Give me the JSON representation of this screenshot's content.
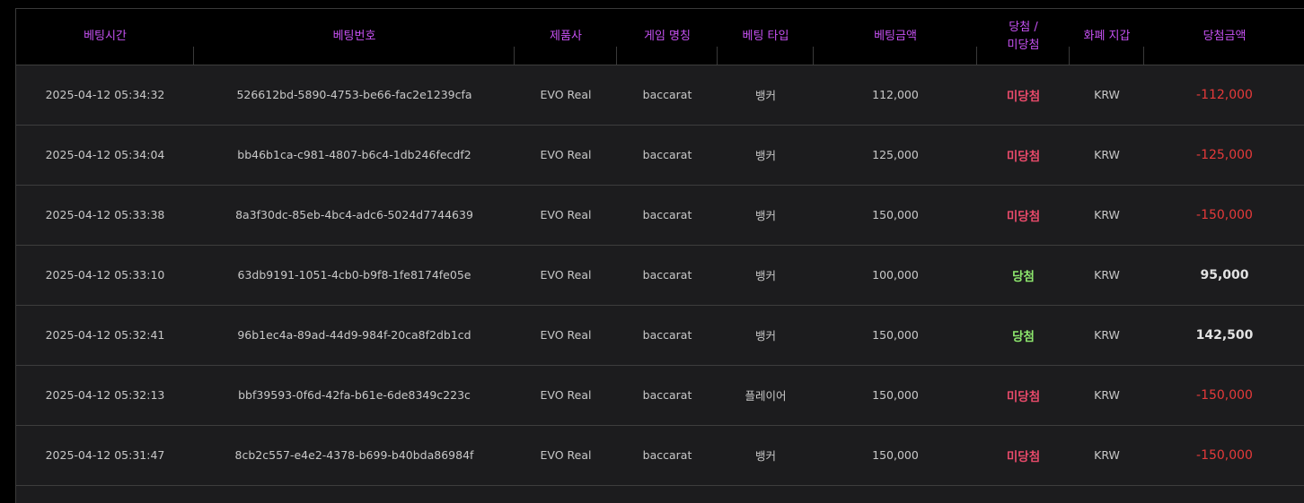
{
  "colors": {
    "header_text": "#c651f2",
    "lose_result": "#e84a6a",
    "win_result": "#8ee86e",
    "lose_amount": "#e53a3a",
    "win_amount": "#e2e2e2"
  },
  "headers": {
    "bet_time": "베팅시간",
    "bet_id": "베팅번호",
    "provider": "제품사",
    "game_name": "게임 명칭",
    "bet_type": "베팅 타입",
    "bet_amount": "베팅금액",
    "result": "당첨 /\n미당첨",
    "currency": "화폐 지갑",
    "win_amount": "당첨금액"
  },
  "rows": [
    {
      "time": "2025-04-12 05:34:32",
      "id": "526612bd-5890-4753-be66-fac2e1239cfa",
      "provider": "EVO Real",
      "game": "baccarat",
      "type": "뱅커",
      "amount": "112,000",
      "result": "미당첨",
      "result_status": "lose",
      "currency": "KRW",
      "payout": "-112,000"
    },
    {
      "time": "2025-04-12 05:34:04",
      "id": "bb46b1ca-c981-4807-b6c4-1db246fecdf2",
      "provider": "EVO Real",
      "game": "baccarat",
      "type": "뱅커",
      "amount": "125,000",
      "result": "미당첨",
      "result_status": "lose",
      "currency": "KRW",
      "payout": "-125,000"
    },
    {
      "time": "2025-04-12 05:33:38",
      "id": "8a3f30dc-85eb-4bc4-adc6-5024d7744639",
      "provider": "EVO Real",
      "game": "baccarat",
      "type": "뱅커",
      "amount": "150,000",
      "result": "미당첨",
      "result_status": "lose",
      "currency": "KRW",
      "payout": "-150,000"
    },
    {
      "time": "2025-04-12 05:33:10",
      "id": "63db9191-1051-4cb0-b9f8-1fe8174fe05e",
      "provider": "EVO Real",
      "game": "baccarat",
      "type": "뱅커",
      "amount": "100,000",
      "result": "당첨",
      "result_status": "win",
      "currency": "KRW",
      "payout": "95,000"
    },
    {
      "time": "2025-04-12 05:32:41",
      "id": "96b1ec4a-89ad-44d9-984f-20ca8f2db1cd",
      "provider": "EVO Real",
      "game": "baccarat",
      "type": "뱅커",
      "amount": "150,000",
      "result": "당첨",
      "result_status": "win",
      "currency": "KRW",
      "payout": "142,500"
    },
    {
      "time": "2025-04-12 05:32:13",
      "id": "bbf39593-0f6d-42fa-b61e-6de8349c223c",
      "provider": "EVO Real",
      "game": "baccarat",
      "type": "플레이어",
      "amount": "150,000",
      "result": "미당첨",
      "result_status": "lose",
      "currency": "KRW",
      "payout": "-150,000"
    },
    {
      "time": "2025-04-12 05:31:47",
      "id": "8cb2c557-e4e2-4378-b699-b40bda86984f",
      "provider": "EVO Real",
      "game": "baccarat",
      "type": "뱅커",
      "amount": "150,000",
      "result": "미당첨",
      "result_status": "lose",
      "currency": "KRW",
      "payout": "-150,000"
    }
  ]
}
